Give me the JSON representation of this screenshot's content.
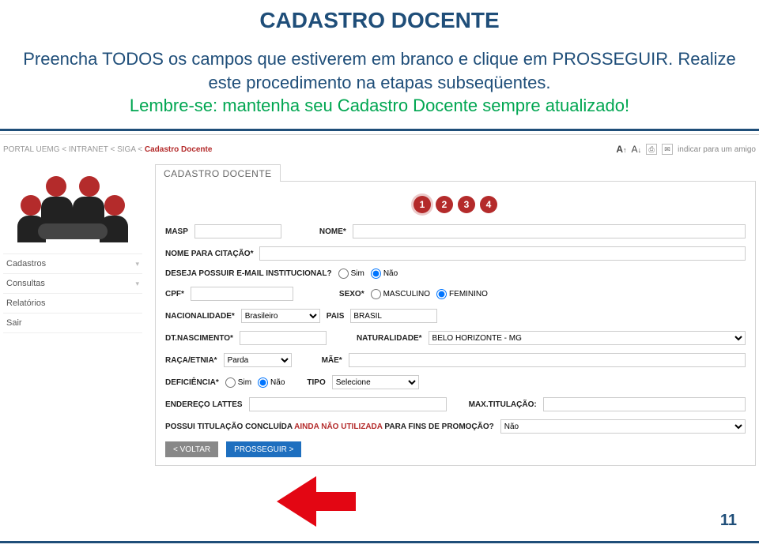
{
  "header": {
    "title": "CADASTRO DOCENTE",
    "instruction_line1a": "Preencha TODOS os campos que estiverem em branco e clique em PROSSEGUIR.",
    "instruction_line1b": "Realize este procedimento na etapas subseqüentes.",
    "instruction_line2": "Lembre-se: mantenha seu Cadastro Docente sempre atualizado!"
  },
  "breadcrumb": {
    "prefix": "PORTAL UEMG < INTRANET < SIGA < ",
    "active": "Cadastro Docente"
  },
  "topright": {
    "a_up": "A",
    "a_down": "A",
    "indicate": "indicar para um amigo"
  },
  "sidebar": {
    "items": [
      "Cadastros",
      "Consultas",
      "Relatórios",
      "Sair"
    ]
  },
  "panel": {
    "tab": "CADASTRO DOCENTE",
    "steps": [
      "1",
      "2",
      "3",
      "4"
    ],
    "active_step": "1"
  },
  "form": {
    "masp_label": "MASP",
    "masp_value": "",
    "nome_label": "NOME*",
    "nome_value": "",
    "citacao_label": "NOME PARA CITAÇÃO*",
    "citacao_value": "",
    "email_inst_label": "DESEJA POSSUIR E-MAIL INSTITUCIONAL?",
    "email_sim": "Sim",
    "email_nao": "Não",
    "cpf_label": "CPF*",
    "cpf_value": "",
    "sexo_label": "SEXO*",
    "sexo_masc": "MASCULINO",
    "sexo_fem": "FEMININO",
    "nacionalidade_label": "NACIONALIDADE*",
    "nacionalidade_value": "Brasileiro",
    "pais_label": "PAIS",
    "pais_value": "BRASIL",
    "dtnasc_label": "DT.NASCIMENTO*",
    "dtnasc_value": "",
    "naturalidade_label": "NATURALIDADE*",
    "naturalidade_value": "BELO HORIZONTE - MG",
    "raca_label": "RAÇA/ETNIA*",
    "raca_value": "Parda",
    "mae_label": "MÃE*",
    "mae_value": "",
    "deficiencia_label": "DEFICIÊNCIA*",
    "def_sim": "Sim",
    "def_nao": "Não",
    "tipo_label": "TIPO",
    "tipo_value": "Selecione",
    "lattes_label": "ENDEREÇO LATTES",
    "lattes_value": "",
    "maxtit_label": "MAX.TITULAÇÃO:",
    "maxtit_value": "",
    "titulacao_q_a": "POSSUI TITULAÇÃO CONCLUÍDA ",
    "titulacao_q_b": "AINDA NÃO UTILIZADA",
    "titulacao_q_c": " PARA FINS DE PROMOÇÃO?",
    "titulacao_value": "Não"
  },
  "actions": {
    "back": "< VOLTAR",
    "go": "PROSSEGUIR >"
  },
  "pagenum": "11"
}
